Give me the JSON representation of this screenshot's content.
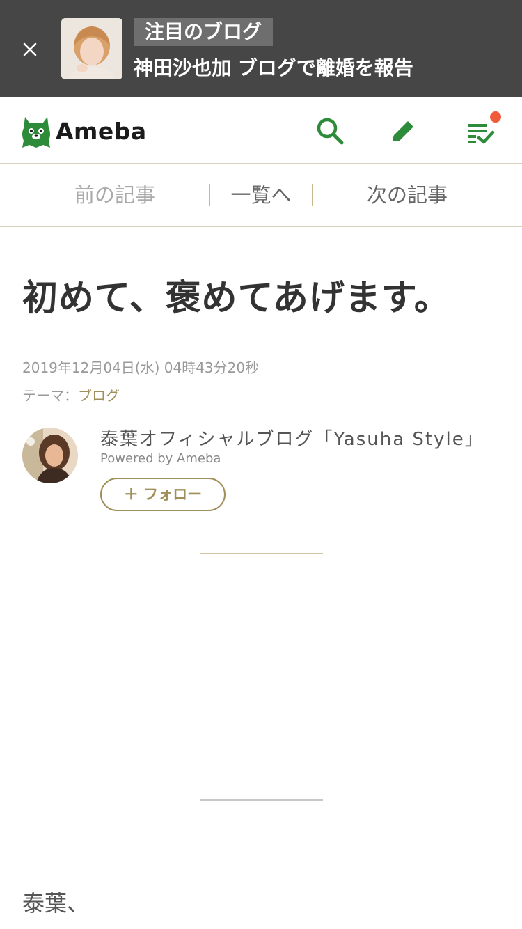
{
  "promo": {
    "badge": "注目のブログ",
    "headline": "神田沙也加 ブログで離婚を報告"
  },
  "header": {
    "logo_text": "Ameba",
    "brand_color": "#2e8b3a"
  },
  "article_nav": {
    "prev": "前の記事",
    "list": "一覧へ",
    "next": "次の記事"
  },
  "article": {
    "title": "初めて、褒めてあげます。",
    "date": "2019年12月04日(水) 04時43分20秒",
    "theme_label": "テーマ：",
    "theme_value": "ブログ",
    "body_start": "泰葉、"
  },
  "author": {
    "blog_name": "泰葉オフィシャルブログ「Yasuha Style」",
    "powered_by": "Powered by Ameba",
    "follow_label": "＋ フォロー"
  }
}
